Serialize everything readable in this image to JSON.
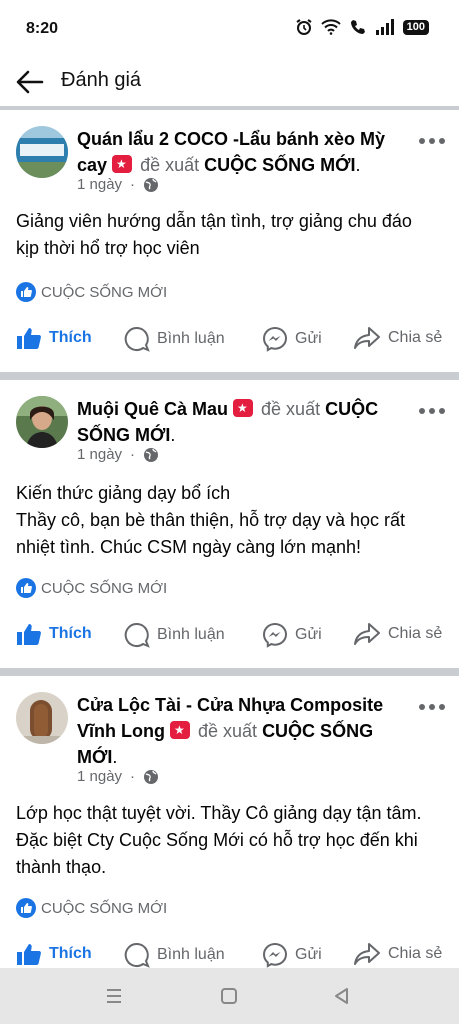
{
  "status_bar": {
    "time": "8:20",
    "battery": "100"
  },
  "header": {
    "title": "Đánh giá"
  },
  "posts": [
    {
      "name": "Quán lẩu 2 COCO -Lẩu bánh xèo Mỳ cay",
      "verb": "đề xuất",
      "page": "CUỘC SỐNG MỚI",
      "time": "1 ngày",
      "text": "Giảng viên hướng dẫn tận tình, trợ giảng chu đáo kịp thời hổ trợ học viên",
      "likes": "CUỘC SỐNG MỚI"
    },
    {
      "name": "Muội Quê Cà Mau",
      "verb": "đề xuất",
      "page": "CUỘC SỐNG MỚI",
      "time": "1 ngày",
      "text": "Kiến thức giảng dạy bổ ích\nThầy cô, bạn bè thân thiện, hỗ trợ dạy và học rất nhiệt tình. Chúc CSM ngày càng lớn mạnh!",
      "likes": "CUỘC SỐNG MỚI"
    },
    {
      "name": "Cửa Lộc Tài - Cửa Nhựa Composite Vĩnh Long",
      "verb": "đề xuất",
      "page": "CUỘC SỐNG MỚI",
      "time": "1 ngày",
      "text": "Lớp học thật tuyệt vời. Thầy Cô giảng dạy tận tâm. Đặc biệt Cty Cuộc Sống Mới có hỗ trợ học đến khi thành thạo.",
      "likes": "CUỘC SỐNG MỚI"
    }
  ],
  "actions": {
    "like": "Thích",
    "comment": "Bình luận",
    "send": "Gửi",
    "share": "Chia sẻ"
  },
  "colors": {
    "accent": "#1b74e4",
    "badge": "#e41e3f",
    "secondary_text": "#65676b"
  }
}
